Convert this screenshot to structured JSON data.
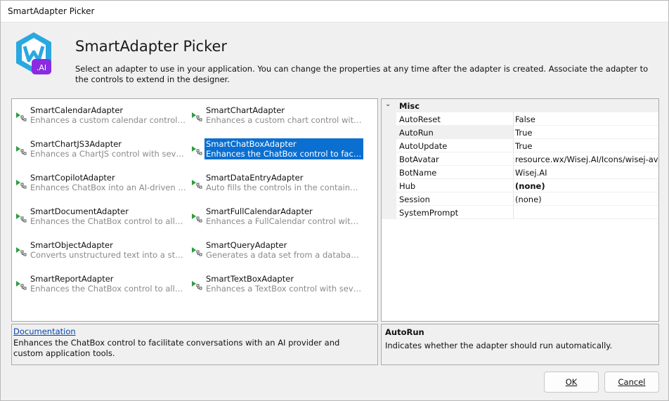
{
  "window": {
    "title": "SmartAdapter Picker"
  },
  "header": {
    "title": "SmartAdapter Picker",
    "description": "Select an adapter to use in your application. You can change the properties at any time after the adapter is created. Associate the adapter to the controls to extend in the designer.",
    "logo_text": ".AI"
  },
  "adapters": [
    {
      "name": "SmartCalendarAdapter",
      "desc": "Enhances a custom calendar control wit..."
    },
    {
      "name": "SmartChartAdapter",
      "desc": "Enhances a custom chart control with se..."
    },
    {
      "name": "SmartChartJS3Adapter",
      "desc": "Enhances a ChartJS control with several ..."
    },
    {
      "name": "SmartChatBoxAdapter",
      "desc": "Enhances the ChatBox control to facilitat..."
    },
    {
      "name": "SmartCopilotAdapter",
      "desc": "Enhances ChatBox into an AI-driven assi..."
    },
    {
      "name": "SmartDataEntryAdapter",
      "desc": "Auto fills the controls in the container ex..."
    },
    {
      "name": "SmartDocumentAdapter",
      "desc": "Enhances the ChatBox control to allow s..."
    },
    {
      "name": "SmartFullCalendarAdapter",
      "desc": "Enhances a FullCalendar control with sev..."
    },
    {
      "name": "SmartObjectAdapter",
      "desc": "Converts unstructured text into a structu..."
    },
    {
      "name": "SmartQueryAdapter",
      "desc": "Generates a data set from a database sch..."
    },
    {
      "name": "SmartReportAdapter",
      "desc": "Enhances the ChatBox control to allow s..."
    },
    {
      "name": "SmartTextBoxAdapter",
      "desc": "Enhances a TextBox control with several ..."
    }
  ],
  "selected_adapter": "SmartChatBoxAdapter",
  "property_grid": {
    "category": "Misc",
    "rows": [
      {
        "name": "AutoReset",
        "value": "False"
      },
      {
        "name": "AutoRun",
        "value": "True"
      },
      {
        "name": "AutoUpdate",
        "value": "True"
      },
      {
        "name": "BotAvatar",
        "value": "resource.wx/Wisej.AI/Icons/wisej-avata"
      },
      {
        "name": "BotName",
        "value": "Wisej.AI"
      },
      {
        "name": "Hub",
        "value": "(none)"
      },
      {
        "name": "Session",
        "value": "(none)"
      },
      {
        "name": "SystemPrompt",
        "value": ""
      }
    ]
  },
  "documentation": {
    "link": "Documentation",
    "text": "Enhances the ChatBox control to facilitate conversations with an AI provider and custom application tools."
  },
  "help": {
    "title": "AutoRun",
    "text": "Indicates whether the adapter should run automatically."
  },
  "buttons": {
    "ok": "OK",
    "cancel": "Cancel"
  },
  "colors": {
    "selection": "#0a6fd1",
    "link": "#0645ad",
    "icon_green": "#2e9e3e"
  }
}
